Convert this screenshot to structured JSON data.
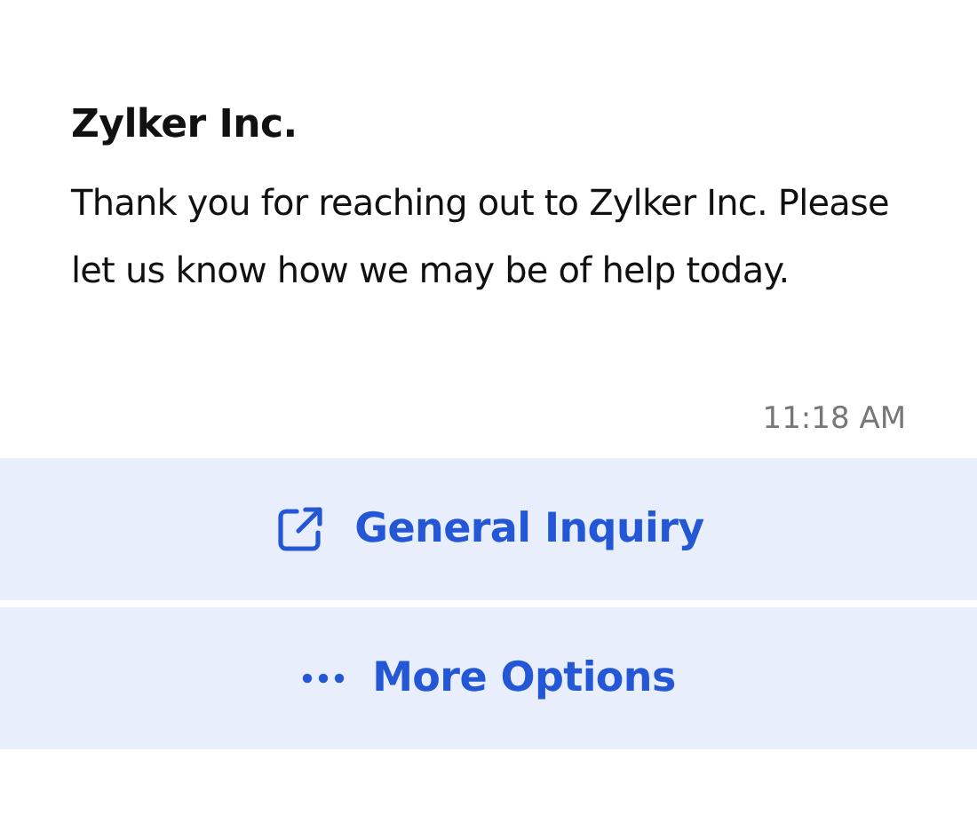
{
  "message": {
    "sender": "Zylker Inc.",
    "text": "Thank you for reaching out to Zylker Inc. Please let us know how we may be of help today.",
    "time": "11:18 AM"
  },
  "actions": [
    {
      "kind": "link",
      "label": "General Inquiry"
    },
    {
      "kind": "more",
      "label": "More Options"
    }
  ]
}
